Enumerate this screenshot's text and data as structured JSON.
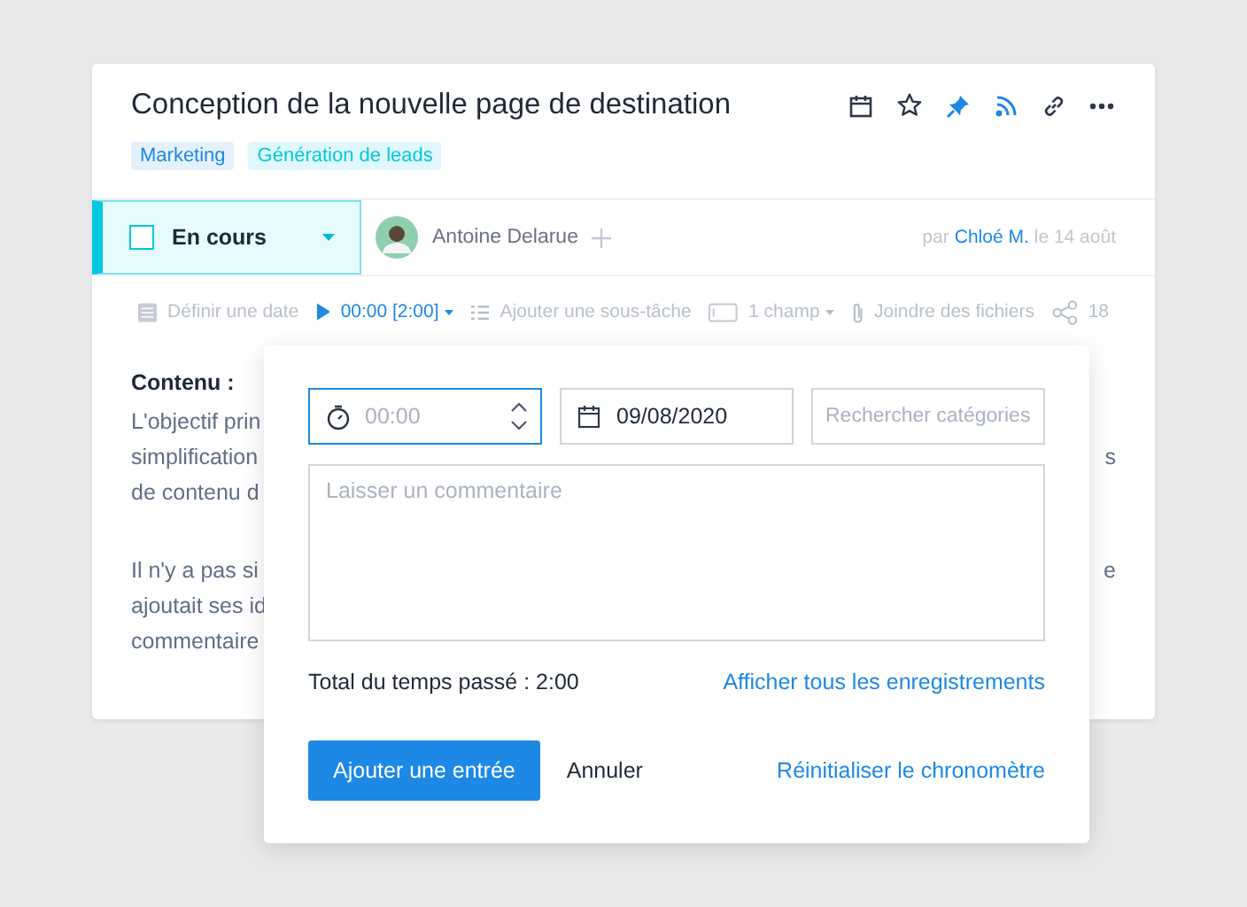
{
  "task": {
    "title": "Conception de la nouvelle page de destination",
    "tags": [
      {
        "label": "Marketing",
        "color": "#1e88e5"
      },
      {
        "label": "Génération de leads",
        "color": "#00c8e0"
      }
    ],
    "status": {
      "label": "En cours",
      "checked": false
    },
    "assignee": "Antoine Delarue",
    "byline": {
      "prefix": "par",
      "author": "Chloé M.",
      "date": "le 14 août"
    },
    "toolbar": [
      {
        "kind": "date",
        "label": "Définir une date"
      },
      {
        "kind": "timer",
        "label": "00:00 [2:00]"
      },
      {
        "kind": "subtask",
        "label": "Ajouter une sous-tâche"
      },
      {
        "kind": "field",
        "label": "1 champ"
      },
      {
        "kind": "attach",
        "label": "Joindre des fichiers"
      },
      {
        "kind": "share",
        "label": "18"
      }
    ],
    "content": {
      "heading": "Contenu :",
      "paragraphs": [
        [
          {
            "left": "L'objectif prin"
          },
          {
            "left": "simplification",
            "right": "s"
          },
          {
            "left": "de contenu d"
          }
        ],
        [
          {
            "left": "Il n'y a pas si",
            "right": "e"
          },
          {
            "left": "ajoutait ses id"
          },
          {
            "left": "commentaire"
          }
        ]
      ]
    }
  },
  "time_popover": {
    "time_field": {
      "placeholder": "00:00"
    },
    "date_field": {
      "value": "09/08/2020"
    },
    "category_field": {
      "placeholder": "Rechercher catégories"
    },
    "comment_field": {
      "placeholder": "Laisser un commentaire"
    },
    "total": "Total du temps passé : 2:00",
    "show_all_link": "Afficher tous les enregistrements",
    "buttons": [
      {
        "kind": "primary",
        "label": "Ajouter une entrée"
      },
      {
        "kind": "plain",
        "label": "Annuler"
      },
      {
        "kind": "link",
        "label": "Réinitialiser le chronomètre"
      }
    ]
  }
}
